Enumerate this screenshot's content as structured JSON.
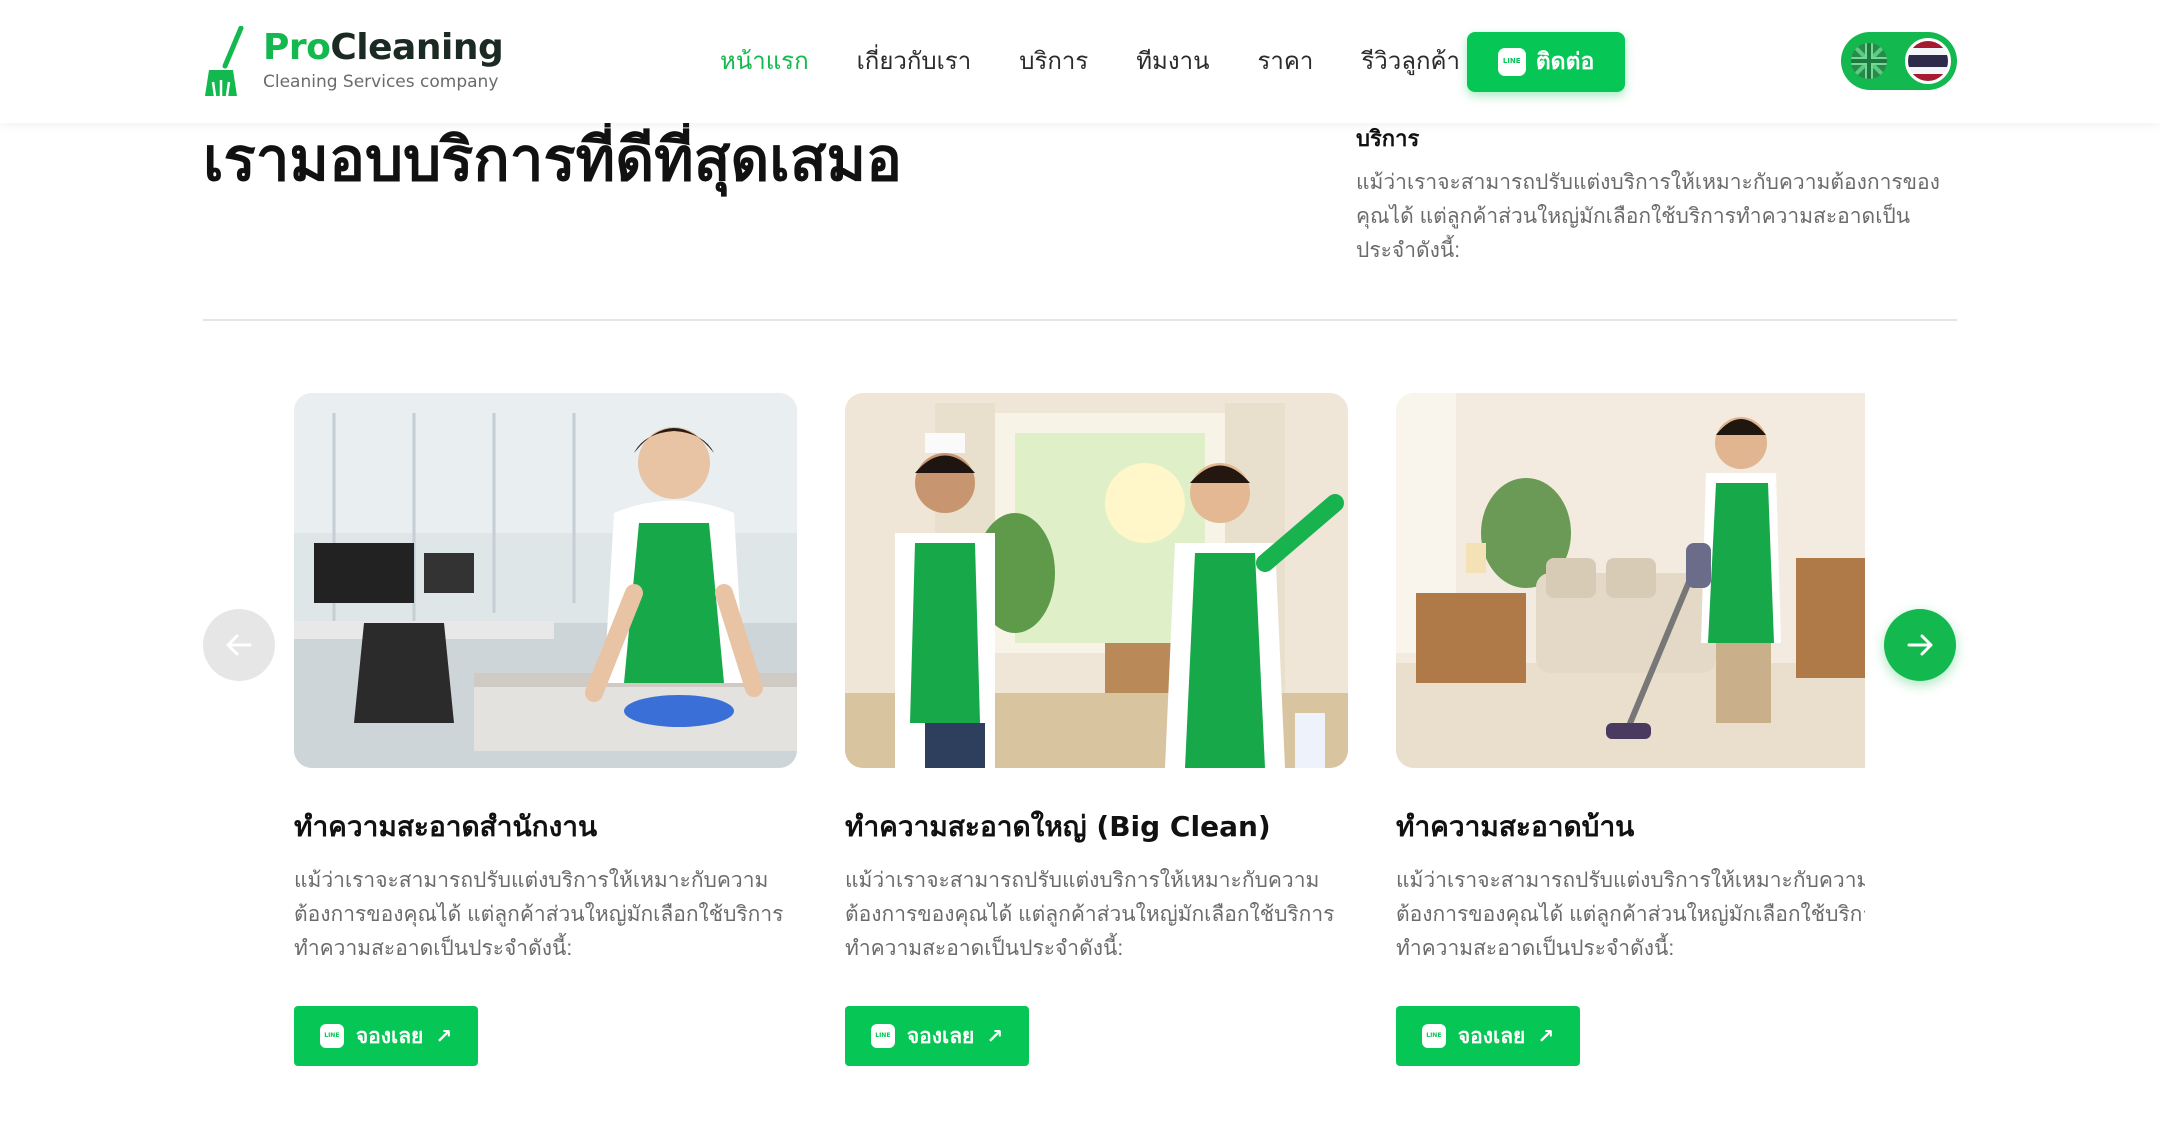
{
  "header": {
    "logo": {
      "brand_pro": "Pro",
      "brand_rest": "Cleaning",
      "tagline": "Cleaning Services company"
    },
    "nav": [
      {
        "label": "หน้าแรก",
        "active": true
      },
      {
        "label": "เกี่ยวกับเรา",
        "active": false
      },
      {
        "label": "บริการ",
        "active": false
      },
      {
        "label": "ทีมงาน",
        "active": false
      },
      {
        "label": "ราคา",
        "active": false
      },
      {
        "label": "รีวิวลูกค้า",
        "active": false
      }
    ],
    "contact_label": "ติดต่อ",
    "language": {
      "options": [
        "EN",
        "TH"
      ],
      "selected": "TH"
    }
  },
  "section": {
    "title": "เรามอบบริการที่ดีที่สุดเสมอ",
    "side_label": "บริการ",
    "side_description": "แม้ว่าเราจะสามารถปรับแต่งบริการให้เหมาะกับความต้องการของคุณได้ แต่ลูกค้าส่วนใหญ่มักเลือกใช้บริการทำความสะอาดเป็นประจำดังนี้:"
  },
  "services": [
    {
      "title": "ทำความสะอาดสำนักงาน",
      "description": "แม้ว่าเราจะสามารถปรับแต่งบริการให้เหมาะกับความต้องการของคุณได้ แต่ลูกค้าส่วนใหญ่มักเลือกใช้บริการทำความสะอาดเป็นประจำดังนี้:",
      "button_label": "จองเลย",
      "image_alt": "office-cleaning-photo"
    },
    {
      "title": "ทำความสะอาดใหญ่ (Big Clean)",
      "description": "แม้ว่าเราจะสามารถปรับแต่งบริการให้เหมาะกับความต้องการของคุณได้ แต่ลูกค้าส่วนใหญ่มักเลือกใช้บริการทำความสะอาดเป็นประจำดังนี้:",
      "button_label": "จองเลย",
      "image_alt": "big-clean-photo"
    },
    {
      "title": "ทำความสะอาดบ้าน",
      "description": "แม้ว่าเราจะสามารถปรับแต่งบริการให้เหมาะกับความต้องการของคุณได้ แต่ลูกค้าส่วนใหญ่มักเลือกใช้บริการทำความสะอาดเป็นประจำดังนี้:",
      "button_label": "จองเลย",
      "image_alt": "house-cleaning-photo"
    }
  ],
  "colors": {
    "brand_green": "#13b84e",
    "line_green": "#06c755",
    "text_dark": "#111111",
    "text_muted": "#6b6b6b"
  },
  "icons": {
    "prev": "arrow-left-icon",
    "next": "arrow-right-icon",
    "line": "line-app-icon",
    "external": "external-link-icon"
  }
}
